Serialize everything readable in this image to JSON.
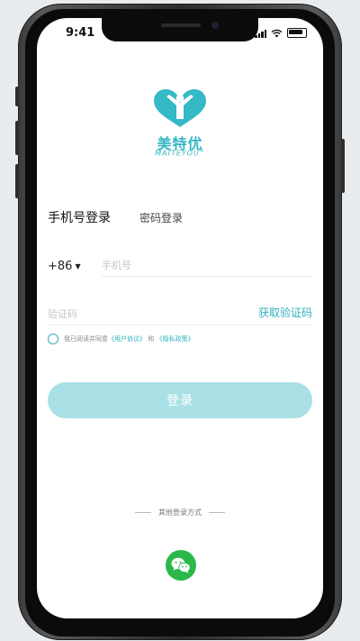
{
  "status_bar": {
    "time": "9:41"
  },
  "brand": {
    "name_cn": "美特优",
    "name_en": "MAITEYOU",
    "registered_mark": "®"
  },
  "tabs": {
    "phone_login": "手机号登录",
    "password_login": "密码登录"
  },
  "phone_field": {
    "country_code": "+86",
    "placeholder": "手机号",
    "value": ""
  },
  "code_field": {
    "placeholder": "验证码",
    "value": "",
    "get_code_label": "获取验证码"
  },
  "agreement": {
    "prefix": "我已阅读并同意",
    "user_agreement": "《用户协议》",
    "and": "和",
    "privacy_policy": "《隐私政策》",
    "checked": false
  },
  "login_button": {
    "label": "登录"
  },
  "other_login": {
    "label": "其他登录方式",
    "options": [
      "wechat-icon"
    ]
  },
  "colors": {
    "accent": "#2fb2bf",
    "button_disabled": "#a8e0e6",
    "wechat": "#2bb84a"
  }
}
